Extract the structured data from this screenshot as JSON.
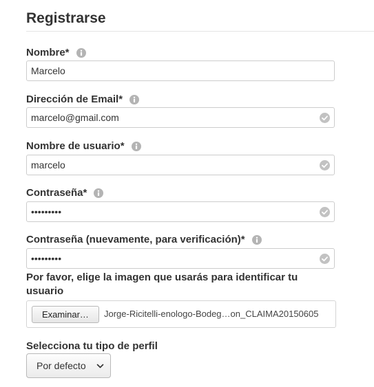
{
  "form": {
    "title": "Registrarse",
    "fields": {
      "name": {
        "label": "Nombre*",
        "value": "Marcelo"
      },
      "email": {
        "label": "Dirección de Email*",
        "value": "marcelo@gmail.com"
      },
      "username": {
        "label": "Nombre de usuario*",
        "value": "marcelo"
      },
      "password": {
        "label": "Contraseña*",
        "value": "•••••••••"
      },
      "password_confirm": {
        "label": "Contraseña (nuevamente, para verificación)*",
        "value": "•••••••••"
      }
    },
    "image_upload": {
      "description": "Por favor, elige la imagen que usarás para identificar tu usuario",
      "button_label": "Examinar…",
      "file_name": "Jorge-Ricitelli-enologo-Bodeg…on_CLAIMA20150605"
    },
    "profile_type": {
      "label": "Selecciona tu tipo de perfil",
      "selected": "Por defecto"
    }
  },
  "icons": {
    "info": "info-circle-icon",
    "valid": "check-circle-icon",
    "dropdown": "chevron-down-icon"
  },
  "colors": {
    "text": "#333333",
    "icon_gray": "#b4b4b4",
    "border": "#cccccc"
  }
}
